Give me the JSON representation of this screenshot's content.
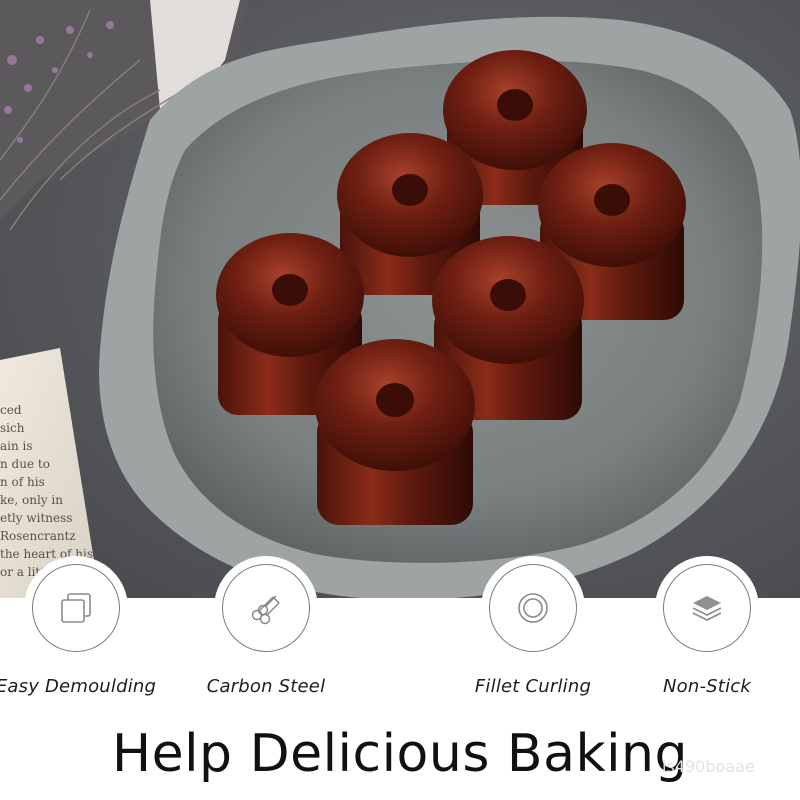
{
  "photo": {
    "subject": "canele-on-tray-photo",
    "book_text": [
      "ced",
      "sich",
      "ain is",
      "n due to",
      "n of his",
      "ke, only in",
      "etly witness",
      "Rosencrantz",
      "the heart of his",
      "or a little"
    ]
  },
  "features": [
    {
      "icon": "overlapping-squares-icon",
      "label": "Easy Demoulding"
    },
    {
      "icon": "steel-rods-icon",
      "label": "Carbon Steel"
    },
    {
      "icon": "concentric-circles-icon",
      "label": "Fillet Curling"
    },
    {
      "icon": "stacked-layers-icon",
      "label": "Non-Stick"
    }
  ],
  "headline": "Help Delicious Baking",
  "watermark": "ls490boaae"
}
